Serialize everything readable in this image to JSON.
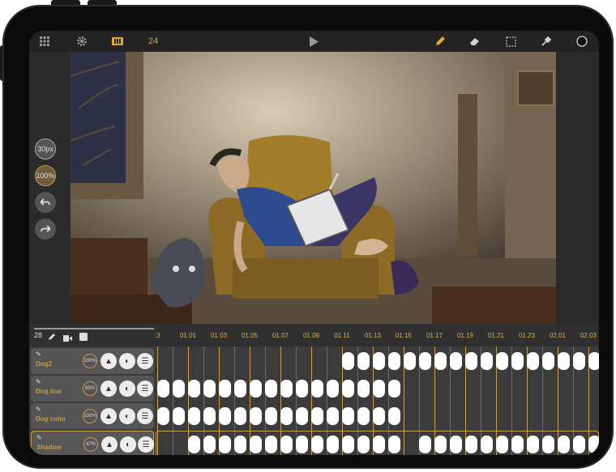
{
  "toolbar": {
    "frame_count_label": "24",
    "icons": [
      "grid-icon",
      "gear-icon",
      "film-icon",
      "play-icon",
      "pencil-icon",
      "eraser-icon",
      "selection-icon",
      "eyedropper-icon",
      "color-circle-icon"
    ],
    "accent": "#e0a83a"
  },
  "sidebar": {
    "brush_size": "30px",
    "opacity": "100%",
    "icons": [
      "undo-icon",
      "redo-icon"
    ]
  },
  "timeline": {
    "current_frame": "28",
    "header_icons": [
      "pencil-icon",
      "camera-icon",
      "onion-skin-icon"
    ],
    "frame_labels": [
      ":3",
      "01.01",
      "01.03",
      "01.05",
      "01.07",
      "01.09",
      "01.11",
      "01.13",
      "01.15",
      "01.17",
      "01.19",
      "01.21",
      "01.23",
      "02.01",
      "02.03"
    ],
    "layers": [
      {
        "name": "Dog2",
        "opacity": "100%"
      },
      {
        "name": "Dog line",
        "opacity": "85%"
      },
      {
        "name": "Dog color",
        "opacity": "100%"
      },
      {
        "name": "Shadow",
        "opacity": "47%"
      }
    ]
  },
  "colors": {
    "accent": "#c69a48",
    "timeline_bg": "#3b3b3b",
    "cell": "#ffffff"
  }
}
